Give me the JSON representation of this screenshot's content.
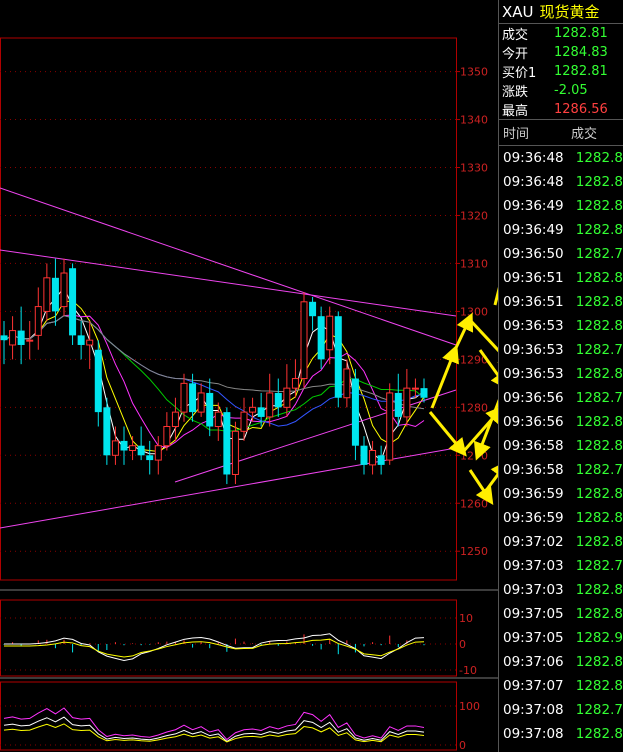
{
  "header": {
    "symbol": "XAU",
    "name": "现货黄金"
  },
  "quote": [
    {
      "label": "成交",
      "value": "1282.81",
      "color": "green"
    },
    {
      "label": "今开",
      "value": "1284.83",
      "color": "green"
    },
    {
      "label": "买价1",
      "value": "1282.81",
      "color": "green"
    },
    {
      "label": "涨跌",
      "value": "-2.05",
      "color": "green"
    },
    {
      "label": "最高",
      "value": "1286.56",
      "color": "red"
    }
  ],
  "ticks_header": {
    "time": "时间",
    "price": "成交"
  },
  "ticks": [
    {
      "time": "09:36:48",
      "price": "1282.8"
    },
    {
      "time": "09:36:48",
      "price": "1282.8"
    },
    {
      "time": "09:36:49",
      "price": "1282.8"
    },
    {
      "time": "09:36:49",
      "price": "1282.8"
    },
    {
      "time": "09:36:50",
      "price": "1282.7"
    },
    {
      "time": "09:36:51",
      "price": "1282.8"
    },
    {
      "time": "09:36:51",
      "price": "1282.8"
    },
    {
      "time": "09:36:53",
      "price": "1282.8"
    },
    {
      "time": "09:36:53",
      "price": "1282.7"
    },
    {
      "time": "09:36:53",
      "price": "1282.8"
    },
    {
      "time": "09:36:56",
      "price": "1282.7"
    },
    {
      "time": "09:36:56",
      "price": "1282.8"
    },
    {
      "time": "09:36:58",
      "price": "1282.8"
    },
    {
      "time": "09:36:58",
      "price": "1282.7"
    },
    {
      "time": "09:36:59",
      "price": "1282.8"
    },
    {
      "time": "09:36:59",
      "price": "1282.8"
    },
    {
      "time": "09:37:02",
      "price": "1282.8"
    },
    {
      "time": "09:37:03",
      "price": "1282.7"
    },
    {
      "time": "09:37:03",
      "price": "1282.8"
    },
    {
      "time": "09:37:05",
      "price": "1282.8"
    },
    {
      "time": "09:37:05",
      "price": "1282.9"
    },
    {
      "time": "09:37:06",
      "price": "1282.8"
    },
    {
      "time": "09:37:07",
      "price": "1282.8"
    },
    {
      "time": "09:37:08",
      "price": "1282.7"
    },
    {
      "time": "09:37:08",
      "price": "1282.8"
    }
  ],
  "chart_data": {
    "type": "candlestick",
    "price_axis": [
      1350,
      1340,
      1330,
      1320,
      1310,
      1300,
      1290,
      1280,
      1270,
      1260,
      1250
    ],
    "ylim": [
      1244,
      1357
    ],
    "macd_axis": [
      "10",
      "0",
      "-10"
    ],
    "kdj_axis": [
      "100",
      "0"
    ],
    "candles": [
      {
        "o": 1295,
        "c": 1294,
        "h": 1298,
        "l": 1289
      },
      {
        "o": 1293,
        "c": 1296,
        "h": 1299,
        "l": 1290
      },
      {
        "o": 1296,
        "c": 1293,
        "h": 1301,
        "l": 1289
      },
      {
        "o": 1294,
        "c": 1294,
        "h": 1298,
        "l": 1290
      },
      {
        "o": 1295,
        "c": 1301,
        "h": 1305,
        "l": 1292
      },
      {
        "o": 1300,
        "c": 1307,
        "h": 1310,
        "l": 1298
      },
      {
        "o": 1307,
        "c": 1300,
        "h": 1311,
        "l": 1297
      },
      {
        "o": 1301,
        "c": 1308,
        "h": 1311,
        "l": 1299
      },
      {
        "o": 1309,
        "c": 1295,
        "h": 1310,
        "l": 1293
      },
      {
        "o": 1295,
        "c": 1293,
        "h": 1298,
        "l": 1290
      },
      {
        "o": 1293,
        "c": 1294,
        "h": 1298,
        "l": 1288
      },
      {
        "o": 1292,
        "c": 1279,
        "h": 1294,
        "l": 1276
      },
      {
        "o": 1280,
        "c": 1270,
        "h": 1282,
        "l": 1268
      },
      {
        "o": 1270,
        "c": 1273,
        "h": 1276,
        "l": 1268
      },
      {
        "o": 1273,
        "c": 1271,
        "h": 1276,
        "l": 1268
      },
      {
        "o": 1271,
        "c": 1272,
        "h": 1274,
        "l": 1269
      },
      {
        "o": 1272,
        "c": 1270,
        "h": 1276,
        "l": 1269
      },
      {
        "o": 1270,
        "c": 1269,
        "h": 1273,
        "l": 1266
      },
      {
        "o": 1269,
        "c": 1272,
        "h": 1274,
        "l": 1266
      },
      {
        "o": 1272,
        "c": 1276,
        "h": 1279,
        "l": 1271
      },
      {
        "o": 1276,
        "c": 1279,
        "h": 1282,
        "l": 1273
      },
      {
        "o": 1279,
        "c": 1285,
        "h": 1287,
        "l": 1277
      },
      {
        "o": 1285,
        "c": 1279,
        "h": 1287,
        "l": 1277
      },
      {
        "o": 1279,
        "c": 1283,
        "h": 1285,
        "l": 1278
      },
      {
        "o": 1283,
        "c": 1276,
        "h": 1286,
        "l": 1274
      },
      {
        "o": 1276,
        "c": 1279,
        "h": 1281,
        "l": 1273
      },
      {
        "o": 1279,
        "c": 1266,
        "h": 1280,
        "l": 1264
      },
      {
        "o": 1266,
        "c": 1275,
        "h": 1277,
        "l": 1264
      },
      {
        "o": 1275,
        "c": 1279,
        "h": 1282,
        "l": 1273
      },
      {
        "o": 1279,
        "c": 1280,
        "h": 1282,
        "l": 1277
      },
      {
        "o": 1280,
        "c": 1278,
        "h": 1283,
        "l": 1276
      },
      {
        "o": 1278,
        "c": 1283,
        "h": 1287,
        "l": 1276
      },
      {
        "o": 1283,
        "c": 1280,
        "h": 1286,
        "l": 1278
      },
      {
        "o": 1280,
        "c": 1284,
        "h": 1289,
        "l": 1278
      },
      {
        "o": 1284,
        "c": 1286,
        "h": 1290,
        "l": 1282
      },
      {
        "o": 1286,
        "c": 1302,
        "h": 1304,
        "l": 1284
      },
      {
        "o": 1302,
        "c": 1299,
        "h": 1303,
        "l": 1296
      },
      {
        "o": 1299,
        "c": 1290,
        "h": 1301,
        "l": 1288
      },
      {
        "o": 1292,
        "c": 1299,
        "h": 1301,
        "l": 1289
      },
      {
        "o": 1299,
        "c": 1282,
        "h": 1300,
        "l": 1280
      },
      {
        "o": 1282,
        "c": 1288,
        "h": 1290,
        "l": 1280
      },
      {
        "o": 1286,
        "c": 1272,
        "h": 1288,
        "l": 1269
      },
      {
        "o": 1272,
        "c": 1268,
        "h": 1274,
        "l": 1266
      },
      {
        "o": 1268,
        "c": 1271,
        "h": 1273,
        "l": 1266
      },
      {
        "o": 1270,
        "c": 1268,
        "h": 1272,
        "l": 1266
      },
      {
        "o": 1269,
        "c": 1283,
        "h": 1285,
        "l": 1268
      },
      {
        "o": 1283,
        "c": 1278,
        "h": 1287,
        "l": 1276
      },
      {
        "o": 1278,
        "c": 1284,
        "h": 1288,
        "l": 1276
      },
      {
        "o": 1284,
        "c": 1284,
        "h": 1286,
        "l": 1282
      },
      {
        "o": 1284,
        "c": 1282,
        "h": 1286,
        "l": 1281
      }
    ]
  }
}
